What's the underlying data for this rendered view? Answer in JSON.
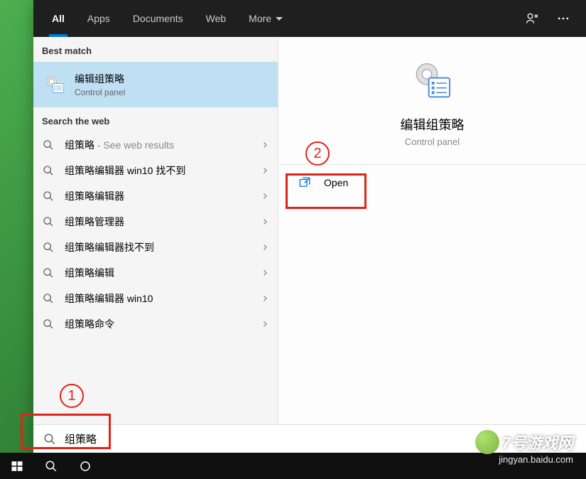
{
  "tabs": {
    "all": "All",
    "apps": "Apps",
    "documents": "Documents",
    "web": "Web",
    "more": "More"
  },
  "sections": {
    "best_match": "Best match",
    "search_web": "Search the web"
  },
  "best_match": {
    "title": "编辑组策略",
    "subtitle": "Control panel"
  },
  "web_results": [
    {
      "term": "组策略",
      "suffix": " - See web results"
    },
    {
      "term": "组策略编辑器 win10 找不到",
      "suffix": ""
    },
    {
      "term": "组策略编辑器",
      "suffix": ""
    },
    {
      "term": "组策略管理器",
      "suffix": ""
    },
    {
      "term": "组策略编辑器找不到",
      "suffix": ""
    },
    {
      "term": "组策略编辑",
      "suffix": ""
    },
    {
      "term": "组策略编辑器 win10",
      "suffix": ""
    },
    {
      "term": "组策略命令",
      "suffix": ""
    }
  ],
  "preview": {
    "title": "编辑组策略",
    "subtitle": "Control panel",
    "open_label": "Open"
  },
  "search": {
    "value": "组策略"
  },
  "annotations": {
    "one": "1",
    "two": "2"
  },
  "watermark": {
    "line1": "7号游戏网",
    "line2": "jingyan.baidu.com"
  }
}
